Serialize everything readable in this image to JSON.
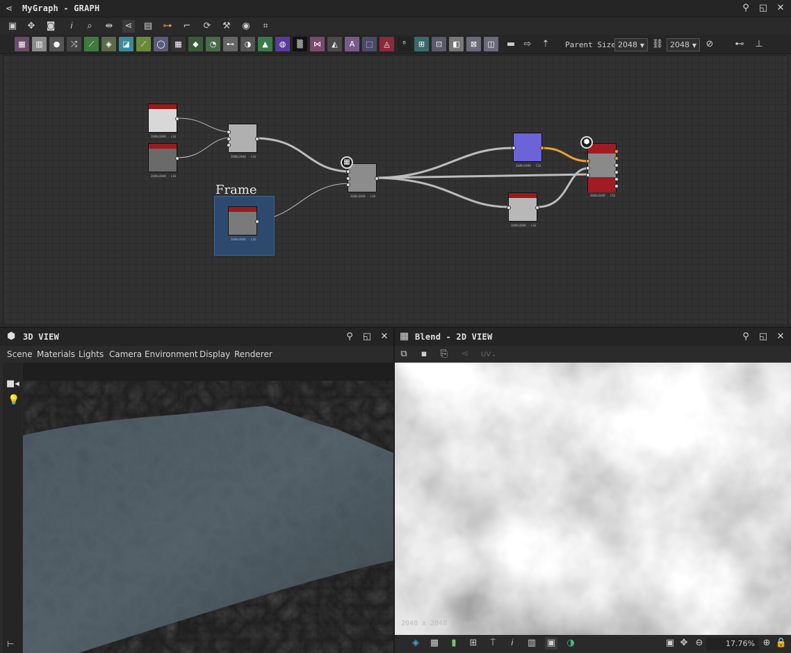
{
  "graph": {
    "title": "MyGraph - GRAPH",
    "frame_label": "Frame",
    "parent_size_label": "Parent Size:",
    "parent_size_w": "2048",
    "parent_size_h": "2048",
    "node_labels": [
      "2048x2048 - L16",
      "2048x2048 - L16",
      "2048x2048 - L16",
      "2048x2048 - L16",
      "2048x2048 - L16",
      "2048x2048 - C16",
      "2048x2048 - C16",
      "2048x2048 - L16"
    ]
  },
  "view3d": {
    "title": "3D VIEW",
    "menu": [
      "Scene",
      "Materials",
      "Lights",
      "Camera",
      "Environment",
      "Display",
      "Renderer"
    ]
  },
  "view2d": {
    "title": "Blend - 2D VIEW",
    "uv_label": "UV",
    "info": "2048 x 2048 (Grayscale, 16bpc)",
    "zoom": "17.76%"
  },
  "colors": {
    "accent": "#f0a030",
    "node_header": "#9a1b1b",
    "frame": "#2d4a6e"
  }
}
